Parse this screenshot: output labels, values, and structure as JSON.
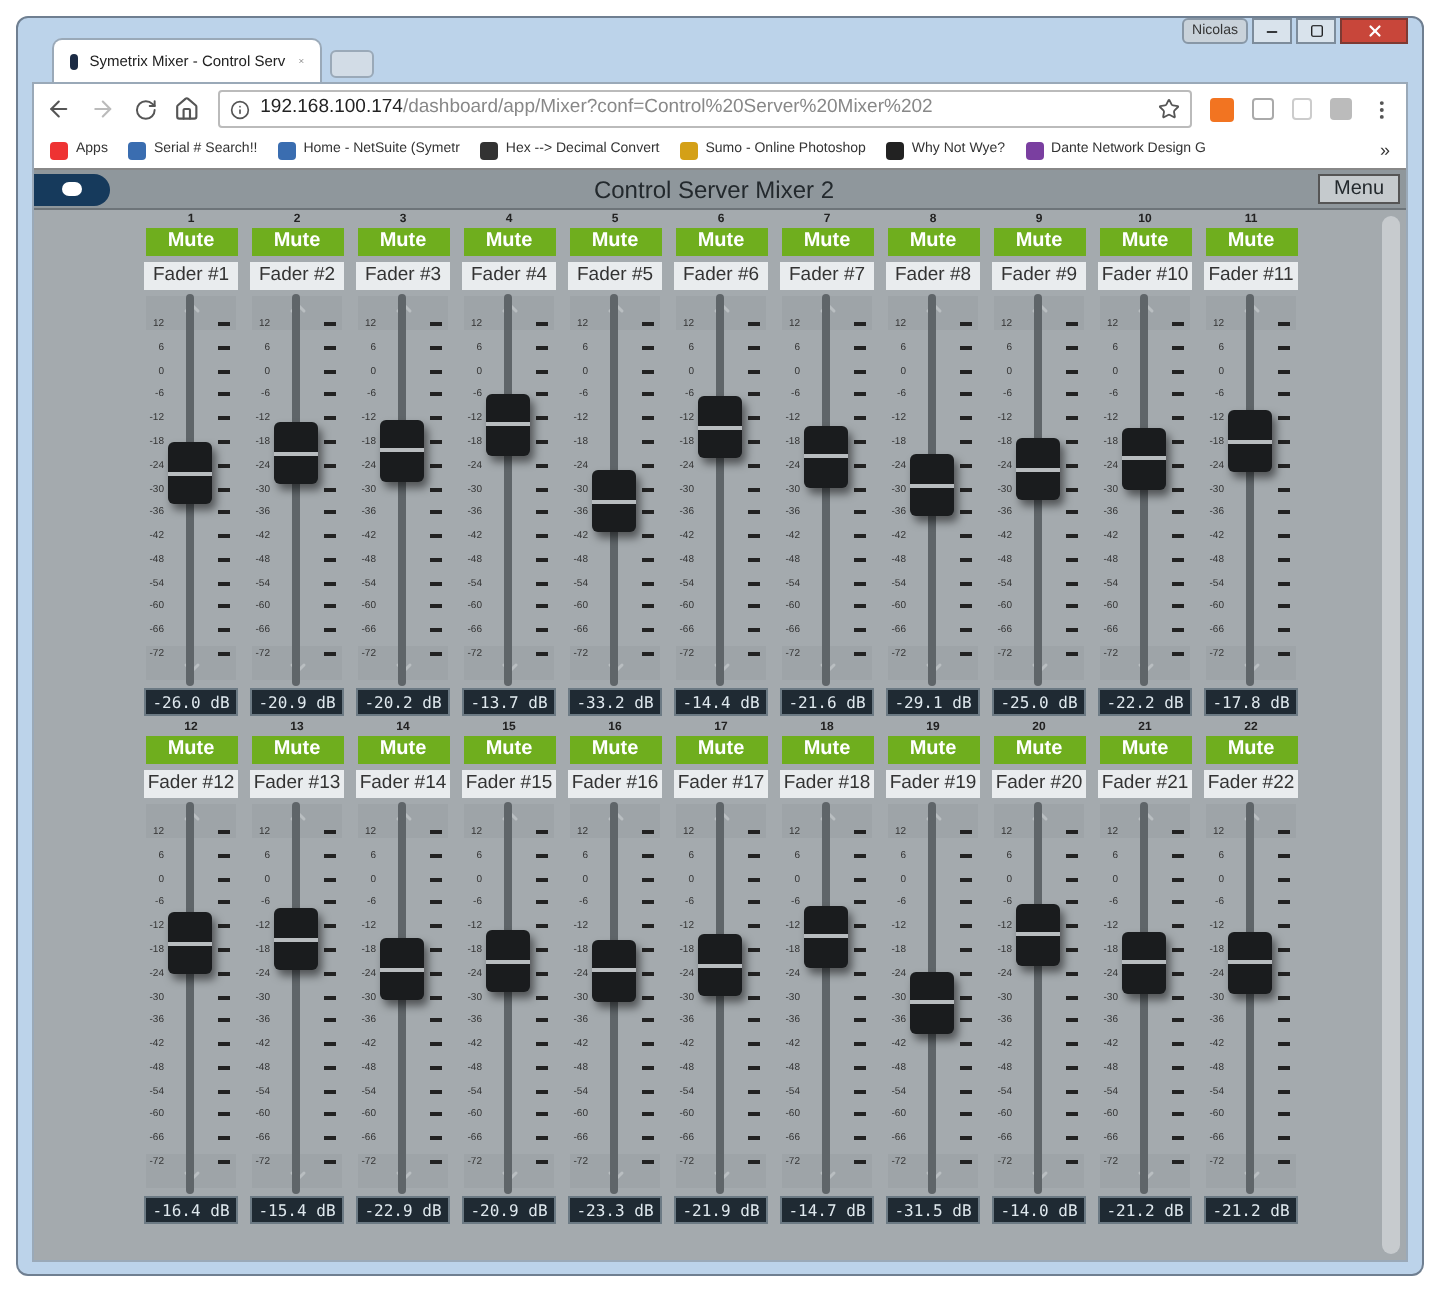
{
  "browser": {
    "user": "Nicolas",
    "tab_title": "Symetrix Mixer - Control Serv",
    "url_host": "192.168.100.174",
    "url_path": "/dashboard/app/Mixer?conf=Control%20Server%20Mixer%202",
    "bookmarks": [
      "Apps",
      "Serial # Search!!",
      "Home - NetSuite (Symetr",
      "Hex --> Decimal Convert",
      "Sumo - Online Photoshop",
      "Why Not Wye?",
      "Dante Network Design G"
    ],
    "bookmarks_more": "»"
  },
  "app": {
    "title": "Control Server Mixer 2",
    "menu": "Menu"
  },
  "faders": [
    {
      "number": "1",
      "mute": "Mute",
      "name": "Fader #1",
      "reading": "-26.0 dB",
      "scale": [
        "12",
        "6",
        "0",
        "-6",
        "-12",
        "-18",
        "-24",
        "-30",
        "-36",
        "-42",
        "-48",
        "-54",
        "-60",
        "-66",
        "-72"
      ]
    },
    {
      "number": "2",
      "mute": "Mute",
      "name": "Fader #2",
      "reading": "-20.9 dB",
      "scale": [
        "12",
        "6",
        "0",
        "-6",
        "-12",
        "-18",
        "-24",
        "-30",
        "-36",
        "-42",
        "-48",
        "-54",
        "-60",
        "-66",
        "-72"
      ]
    },
    {
      "number": "3",
      "mute": "Mute",
      "name": "Fader #3",
      "reading": "-20.2 dB",
      "scale": [
        "12",
        "6",
        "0",
        "-6",
        "-12",
        "-18",
        "-24",
        "-30",
        "-36",
        "-42",
        "-48",
        "-54",
        "-60",
        "-66",
        "-72"
      ]
    },
    {
      "number": "4",
      "mute": "Mute",
      "name": "Fader #4",
      "reading": "-13.7 dB",
      "scale": [
        "12",
        "6",
        "0",
        "-6",
        "-12",
        "-18",
        "-24",
        "-30",
        "-36",
        "-42",
        "-48",
        "-54",
        "-60",
        "-66",
        "-72"
      ]
    },
    {
      "number": "5",
      "mute": "Mute",
      "name": "Fader #5",
      "reading": "-33.2 dB",
      "scale": [
        "12",
        "6",
        "0",
        "-6",
        "-12",
        "-18",
        "-24",
        "-30",
        "-36",
        "-42",
        "-48",
        "-54",
        "-60",
        "-66",
        "-72"
      ]
    },
    {
      "number": "6",
      "mute": "Mute",
      "name": "Fader #6",
      "reading": "-14.4 dB",
      "scale": [
        "12",
        "6",
        "0",
        "-6",
        "-12",
        "-18",
        "-24",
        "-30",
        "-36",
        "-42",
        "-48",
        "-54",
        "-60",
        "-66",
        "-72"
      ]
    },
    {
      "number": "7",
      "mute": "Mute",
      "name": "Fader #7",
      "reading": "-21.6 dB",
      "scale": [
        "12",
        "6",
        "0",
        "-6",
        "-12",
        "-18",
        "-24",
        "-30",
        "-36",
        "-42",
        "-48",
        "-54",
        "-60",
        "-66",
        "-72"
      ]
    },
    {
      "number": "8",
      "mute": "Mute",
      "name": "Fader #8",
      "reading": "-29.1 dB",
      "scale": [
        "12",
        "6",
        "0",
        "-6",
        "-12",
        "-18",
        "-24",
        "-30",
        "-36",
        "-42",
        "-48",
        "-54",
        "-60",
        "-66",
        "-72"
      ]
    },
    {
      "number": "9",
      "mute": "Mute",
      "name": "Fader #9",
      "reading": "-25.0 dB",
      "scale": [
        "12",
        "6",
        "0",
        "-6",
        "-12",
        "-18",
        "-24",
        "-30",
        "-36",
        "-42",
        "-48",
        "-54",
        "-60",
        "-66",
        "-72"
      ]
    },
    {
      "number": "10",
      "mute": "Mute",
      "name": "Fader #10",
      "reading": "-22.2 dB",
      "scale": [
        "12",
        "6",
        "0",
        "-6",
        "-12",
        "-18",
        "-24",
        "-30",
        "-36",
        "-42",
        "-48",
        "-54",
        "-60",
        "-66",
        "-72"
      ]
    },
    {
      "number": "11",
      "mute": "Mute",
      "name": "Fader #11",
      "reading": "-17.8 dB",
      "scale": [
        "12",
        "6",
        "0",
        "-6",
        "-12",
        "-18",
        "-24",
        "-30",
        "-36",
        "-42",
        "-48",
        "-54",
        "-60",
        "-66",
        "-72"
      ]
    },
    {
      "number": "12",
      "mute": "Mute",
      "name": "Fader #12",
      "reading": "-16.4 dB",
      "scale": [
        "12",
        "6",
        "0",
        "-6",
        "-12",
        "-18",
        "-24",
        "-30",
        "-36",
        "-42",
        "-48",
        "-54",
        "-60",
        "-66",
        "-72"
      ]
    },
    {
      "number": "13",
      "mute": "Mute",
      "name": "Fader #13",
      "reading": "-15.4 dB",
      "scale": [
        "12",
        "6",
        "0",
        "-6",
        "-12",
        "-18",
        "-24",
        "-30",
        "-36",
        "-42",
        "-48",
        "-54",
        "-60",
        "-66",
        "-72"
      ]
    },
    {
      "number": "14",
      "mute": "Mute",
      "name": "Fader #14",
      "reading": "-22.9 dB",
      "scale": [
        "12",
        "6",
        "0",
        "-6",
        "-12",
        "-18",
        "-24",
        "-30",
        "-36",
        "-42",
        "-48",
        "-54",
        "-60",
        "-66",
        "-72"
      ]
    },
    {
      "number": "15",
      "mute": "Mute",
      "name": "Fader #15",
      "reading": "-20.9 dB",
      "scale": [
        "12",
        "6",
        "0",
        "-6",
        "-12",
        "-18",
        "-24",
        "-30",
        "-36",
        "-42",
        "-48",
        "-54",
        "-60",
        "-66",
        "-72"
      ]
    },
    {
      "number": "16",
      "mute": "Mute",
      "name": "Fader #16",
      "reading": "-23.3 dB",
      "scale": [
        "12",
        "6",
        "0",
        "-6",
        "-12",
        "-18",
        "-24",
        "-30",
        "-36",
        "-42",
        "-48",
        "-54",
        "-60",
        "-66",
        "-72"
      ]
    },
    {
      "number": "17",
      "mute": "Mute",
      "name": "Fader #17",
      "reading": "-21.9 dB",
      "scale": [
        "12",
        "6",
        "0",
        "-6",
        "-12",
        "-18",
        "-24",
        "-30",
        "-36",
        "-42",
        "-48",
        "-54",
        "-60",
        "-66",
        "-72"
      ]
    },
    {
      "number": "18",
      "mute": "Mute",
      "name": "Fader #18",
      "reading": "-14.7 dB",
      "scale": [
        "12",
        "6",
        "0",
        "-6",
        "-12",
        "-18",
        "-24",
        "-30",
        "-36",
        "-42",
        "-48",
        "-54",
        "-60",
        "-66",
        "-72"
      ]
    },
    {
      "number": "19",
      "mute": "Mute",
      "name": "Fader #19",
      "reading": "-31.5 dB",
      "scale": [
        "12",
        "6",
        "0",
        "-6",
        "-12",
        "-18",
        "-24",
        "-30",
        "-36",
        "-42",
        "-48",
        "-54",
        "-60",
        "-66",
        "-72"
      ]
    },
    {
      "number": "20",
      "mute": "Mute",
      "name": "Fader #20",
      "reading": "-14.0 dB",
      "scale": [
        "12",
        "6",
        "0",
        "-6",
        "-12",
        "-18",
        "-24",
        "-30",
        "-36",
        "-42",
        "-48",
        "-54",
        "-60",
        "-66",
        "-72"
      ]
    },
    {
      "number": "21",
      "mute": "Mute",
      "name": "Fader #21",
      "reading": "-21.2 dB",
      "scale": [
        "12",
        "6",
        "0",
        "-6",
        "-12",
        "-18",
        "-24",
        "-30",
        "-36",
        "-42",
        "-48",
        "-54",
        "-60",
        "-66",
        "-72"
      ]
    },
    {
      "number": "22",
      "mute": "Mute",
      "name": "Fader #22",
      "reading": "-21.2 dB",
      "scale": [
        "12",
        "6",
        "0",
        "-6",
        "-12",
        "-18",
        "-24",
        "-30",
        "-36",
        "-42",
        "-48",
        "-54",
        "-60",
        "-66",
        "-72"
      ]
    }
  ]
}
